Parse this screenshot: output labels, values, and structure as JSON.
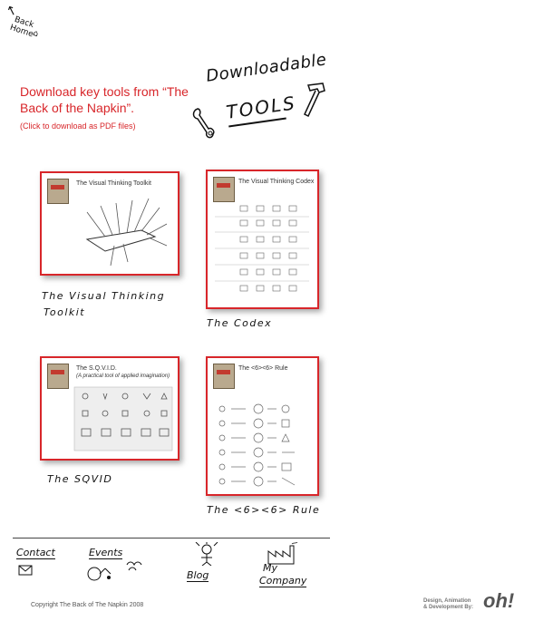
{
  "nav_home": {
    "label_1": "Back",
    "label_2": "Home"
  },
  "intro": {
    "title": "Download key tools from “The Back of the Napkin”.",
    "subtitle": "(Click to download as PDF files)"
  },
  "heading": {
    "line1": "Downloadable",
    "line2": "TOOLS"
  },
  "tools": [
    {
      "doc_title": "The Visual Thinking Toolkit",
      "caption_1": "The Visual Thinking",
      "caption_2": "Toolkit"
    },
    {
      "doc_title": "The Visual Thinking Codex",
      "caption_1": "The Codex",
      "caption_2": ""
    },
    {
      "doc_title": "The S.Q.V.I.D.",
      "doc_subtitle": "(A practical tool of applied imagination)",
      "caption_1": "The SQVID",
      "caption_2": ""
    },
    {
      "doc_title": "The <6><6> Rule",
      "caption_1": "The <6><6> Rule",
      "caption_2": ""
    }
  ],
  "footer": {
    "nav": [
      "Contact",
      "Events",
      "Blog",
      "My",
      "Company"
    ],
    "copyright": "Copyright The Back of The Napkin 2008",
    "credits_1": "Design, Animation",
    "credits_2": "& Development By:",
    "logo": "oh!"
  }
}
